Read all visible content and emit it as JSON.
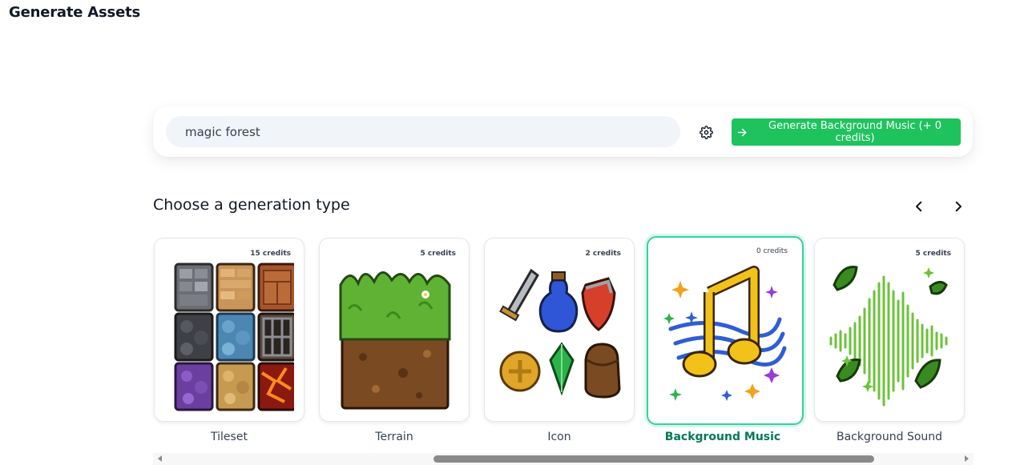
{
  "page": {
    "title": "Generate Assets"
  },
  "prompt": {
    "value": "magic forest",
    "generate_label": "Generate Background Music (+ 0 credits)"
  },
  "section": {
    "title": "Choose a generation type"
  },
  "icons": {
    "settings": "gear-icon",
    "generate": "arrow-right-icon",
    "prev": "chevron-left-icon",
    "next": "chevron-right-icon"
  },
  "cards": [
    {
      "label": "Tileset",
      "credits": "15 credits",
      "selected": false
    },
    {
      "label": "Terrain",
      "credits": "5 credits",
      "selected": false
    },
    {
      "label": "Icon",
      "credits": "2 credits",
      "selected": false
    },
    {
      "label": "Background Music",
      "credits": "0 credits",
      "selected": true
    },
    {
      "label": "Background Sound",
      "credits": "5 credits",
      "selected": false
    }
  ],
  "colors": {
    "accent": "#1ec35e",
    "selected_border": "#34d399",
    "selected_label": "#047857"
  }
}
